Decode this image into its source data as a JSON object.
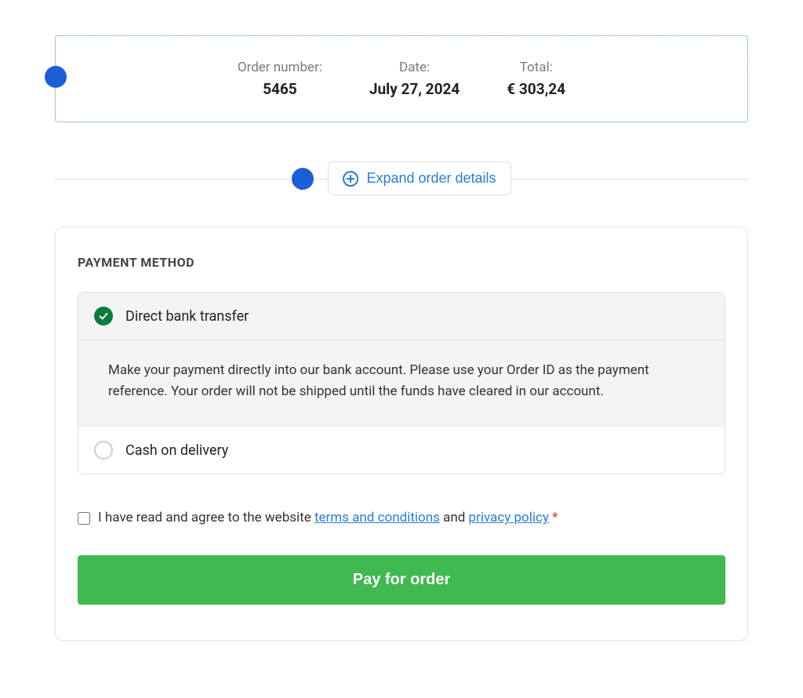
{
  "order_summary": {
    "order_number_label": "Order number:",
    "order_number_value": "5465",
    "date_label": "Date:",
    "date_value": "July 27, 2024",
    "total_label": "Total:",
    "total_value": "€ 303,24"
  },
  "expand": {
    "label": "Expand order details"
  },
  "payment": {
    "heading": "PAYMENT METHOD",
    "options": [
      {
        "label": "Direct bank transfer",
        "selected": true,
        "description": "Make your payment directly into our bank account. Please use your Order ID as the payment reference. Your order will not be shipped until the funds have cleared in our account."
      },
      {
        "label": "Cash on delivery",
        "selected": false
      }
    ]
  },
  "agreement": {
    "prefix": "I have read and agree to the website ",
    "terms_link": "terms and conditions",
    "middle": " and ",
    "privacy_link": "privacy policy",
    "asterisk": " *"
  },
  "pay_button": {
    "label": "Pay for order"
  }
}
